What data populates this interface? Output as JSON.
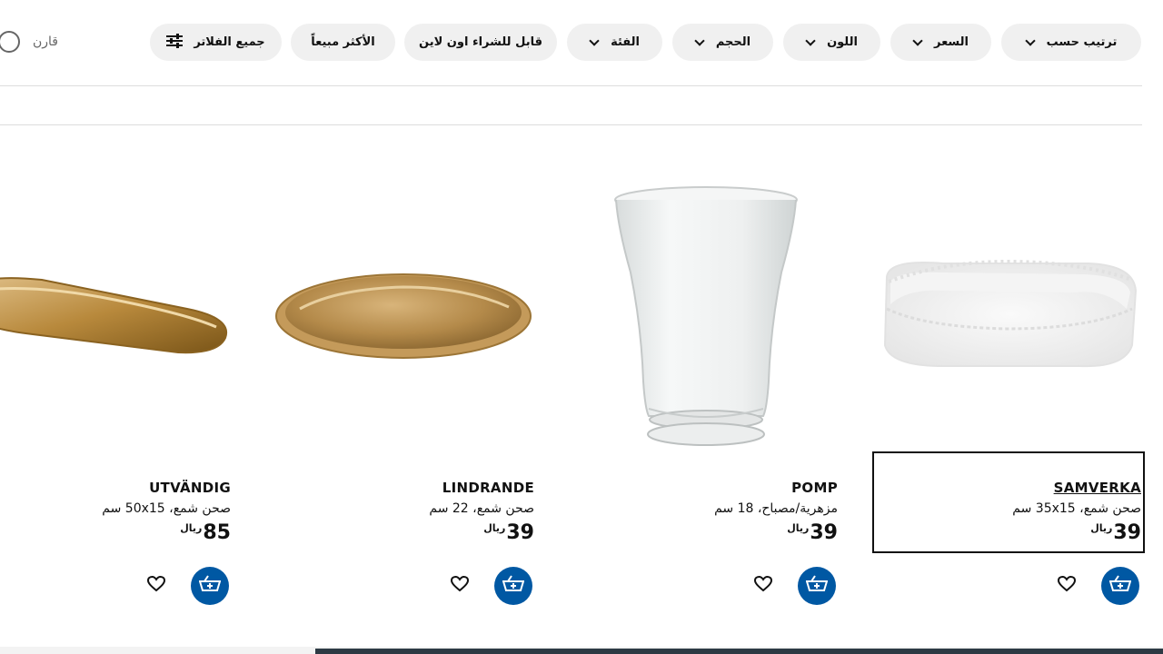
{
  "filters": {
    "sort_label": "ترتيب حسب",
    "price_label": "السعر",
    "color_label": "اللون",
    "size_label": "الحجم",
    "category_label": "الفئة",
    "online_label": "قابل للشراء اون لاين",
    "bestseller_label": "الأكثر مبيعاً",
    "all_filters_label": "جميع الفلاتر",
    "compare_label": "قارن"
  },
  "products": [
    {
      "name": "SAMVERKA",
      "desc": "صحن شمع، 35x15 سم",
      "price": "39",
      "currency": "ريال",
      "image": "white-lace-tray"
    },
    {
      "name": "POMP",
      "desc": "مزهرية/مصباح، 18 سم",
      "price": "39",
      "currency": "ريال",
      "image": "glass-vase"
    },
    {
      "name": "LINDRANDE",
      "desc": "صحن شمع، 22 سم",
      "price": "39",
      "currency": "ريال",
      "image": "gold-round-plate"
    },
    {
      "name": "UTVÄNDIG",
      "desc": "صحن شمع، 50x15 سم",
      "price": "85",
      "currency": "ريال",
      "image": "gold-oval-tray"
    }
  ],
  "colors": {
    "accent": "#0058a3",
    "chip_bg": "#f0f0f0"
  }
}
